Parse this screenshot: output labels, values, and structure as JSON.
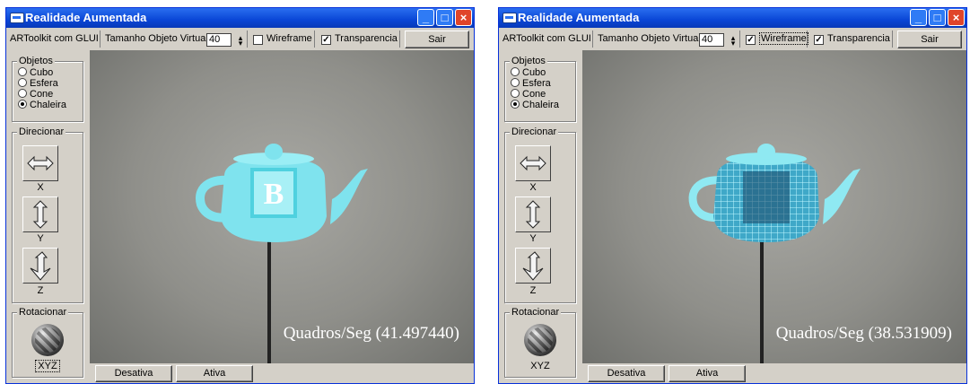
{
  "windows": [
    {
      "title": "Realidade Aumentada",
      "toolbar": {
        "artoolkit_label": "ARToolkit com GLUI",
        "size_label": "Tamanho Objeto Virtual",
        "size_value": "40",
        "wireframe_label": "Wireframe",
        "wireframe_checked": false,
        "transparencia_label": "Transparencia",
        "transparencia_checked": true,
        "sair_label": "Sair"
      },
      "objetos": {
        "title": "Objetos",
        "options": [
          "Cubo",
          "Esfera",
          "Cone",
          "Chaleira"
        ],
        "selected": "Chaleira"
      },
      "direcionar": {
        "title": "Direcionar",
        "axes": [
          "X",
          "Y",
          "Z"
        ]
      },
      "rotacionar": {
        "title": "Rotacionar",
        "label": "XYZ"
      },
      "fps": "Quadros/Seg (41.497440)",
      "buttons": {
        "desativa": "Desativa",
        "ativa": "Ativa"
      },
      "colors": {
        "teapot": "#7fe3ee",
        "title_blue": "#0a46d6"
      }
    },
    {
      "title": "Realidade Aumentada",
      "toolbar": {
        "artoolkit_label": "ARToolkit com GLUI",
        "size_label": "Tamanho Objeto Virtual",
        "size_value": "40",
        "wireframe_label": "Wireframe",
        "wireframe_checked": true,
        "transparencia_label": "Transparencia",
        "transparencia_checked": true,
        "sair_label": "Sair"
      },
      "objetos": {
        "title": "Objetos",
        "options": [
          "Cubo",
          "Esfera",
          "Cone",
          "Chaleira"
        ],
        "selected": "Chaleira"
      },
      "direcionar": {
        "title": "Direcionar",
        "axes": [
          "X",
          "Y",
          "Z"
        ]
      },
      "rotacionar": {
        "title": "Rotacionar",
        "label": "XYZ"
      },
      "fps": "Quadros/Seg (38.531909)",
      "buttons": {
        "desativa": "Desativa",
        "ativa": "Ativa"
      },
      "colors": {
        "teapot": "#7fe3ee",
        "title_blue": "#0a46d6"
      }
    }
  ]
}
